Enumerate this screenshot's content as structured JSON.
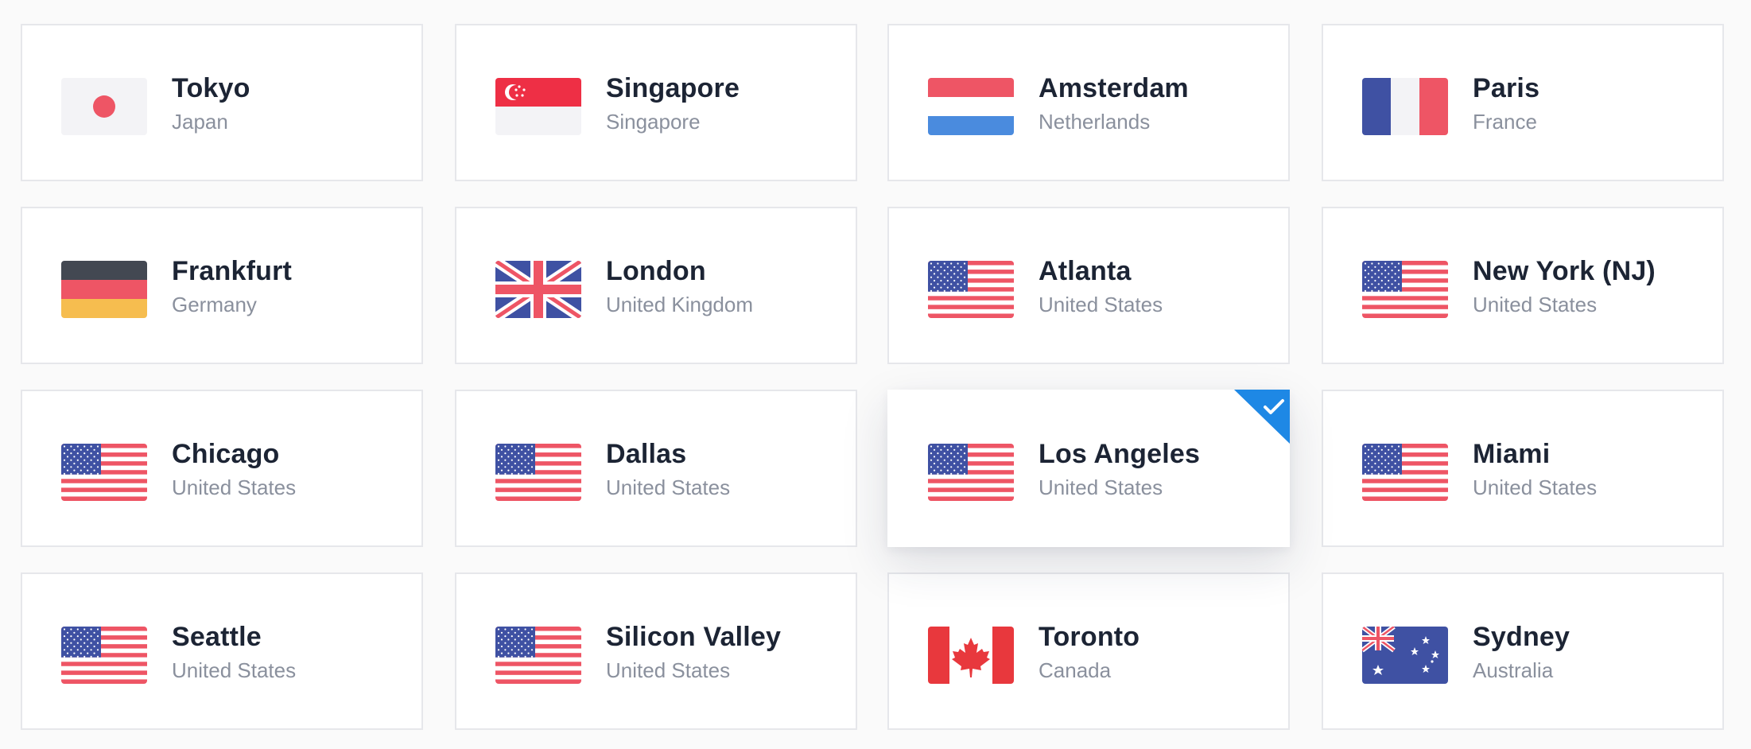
{
  "locations": [
    {
      "city": "Tokyo",
      "country": "Japan",
      "flag": "japan-flag-icon",
      "selected": false
    },
    {
      "city": "Singapore",
      "country": "Singapore",
      "flag": "singapore-flag-icon",
      "selected": false
    },
    {
      "city": "Amsterdam",
      "country": "Netherlands",
      "flag": "netherlands-flag-icon",
      "selected": false
    },
    {
      "city": "Paris",
      "country": "France",
      "flag": "france-flag-icon",
      "selected": false
    },
    {
      "city": "Frankfurt",
      "country": "Germany",
      "flag": "germany-flag-icon",
      "selected": false
    },
    {
      "city": "London",
      "country": "United Kingdom",
      "flag": "uk-flag-icon",
      "selected": false
    },
    {
      "city": "Atlanta",
      "country": "United States",
      "flag": "us-flag-icon",
      "selected": false
    },
    {
      "city": "New York (NJ)",
      "country": "United States",
      "flag": "us-flag-icon",
      "selected": false
    },
    {
      "city": "Chicago",
      "country": "United States",
      "flag": "us-flag-icon",
      "selected": false
    },
    {
      "city": "Dallas",
      "country": "United States",
      "flag": "us-flag-icon",
      "selected": false
    },
    {
      "city": "Los Angeles",
      "country": "United States",
      "flag": "us-flag-icon",
      "selected": true
    },
    {
      "city": "Miami",
      "country": "United States",
      "flag": "us-flag-icon",
      "selected": false
    },
    {
      "city": "Seattle",
      "country": "United States",
      "flag": "us-flag-icon",
      "selected": false
    },
    {
      "city": "Silicon Valley",
      "country": "United States",
      "flag": "us-flag-icon",
      "selected": false
    },
    {
      "city": "Toronto",
      "country": "Canada",
      "flag": "canada-flag-icon",
      "selected": false
    },
    {
      "city": "Sydney",
      "country": "Australia",
      "flag": "australia-flag-icon",
      "selected": false
    }
  ],
  "colors": {
    "accent": "#1e88e5",
    "card_border": "#e6e7eb",
    "city_text": "#1c2434",
    "country_text": "#8a909d"
  },
  "selected_icon": "checkmark-icon"
}
